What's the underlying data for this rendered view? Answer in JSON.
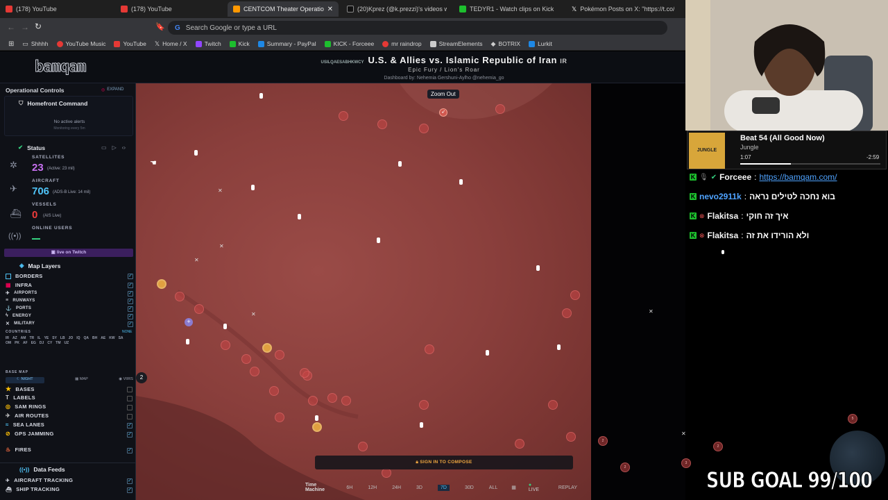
{
  "browser": {
    "tabs": [
      {
        "label": "(178) YouTube",
        "color": "#e53935"
      },
      {
        "label": "(178) YouTube",
        "color": "#e53935"
      },
      {
        "label": "CENTCOM Theater Operations M",
        "color": "#ff9800"
      },
      {
        "label": "(20)Kprez (@k.prezzi)'s videos with c",
        "color": "#111111"
      },
      {
        "label": "TEDYR1 - Watch clips on Kick",
        "color": "#1dbf2e"
      },
      {
        "label": "Pokémon Posts on X: \"https://t.co/8i",
        "color": "#222222"
      }
    ],
    "omnibox_placeholder": "Search Google or type a URL",
    "bookmarks": [
      {
        "label": "Shhhh",
        "color": "#888888"
      },
      {
        "label": "YouTube Music",
        "color": "#e53935"
      },
      {
        "label": "YouTube",
        "color": "#e53935"
      },
      {
        "label": "Home / X",
        "color": "#dddddd"
      },
      {
        "label": "Twitch",
        "color": "#9146ff"
      },
      {
        "label": "Kick",
        "color": "#1dbf2e"
      },
      {
        "label": "Summary - PayPal",
        "color": "#1e88e5"
      },
      {
        "label": "KICK - Forceee",
        "color": "#1dbf2e"
      },
      {
        "label": "mr raindrop",
        "color": "#e53935"
      },
      {
        "label": "StreamElements",
        "color": "#cccccc"
      },
      {
        "label": "BOTRIX",
        "color": "#cccccc"
      },
      {
        "label": "Lurkit",
        "color": "#1e88e5"
      }
    ]
  },
  "header": {
    "logo": "bamqam",
    "prefix": "USILQAESABHKWCY",
    "title": "U.S. & Allies vs. Islamic Republic of Iran",
    "flag_code": "IR",
    "subtitle": "Epic Fury / Lion's Roar",
    "byline": "Dashboard by: Nehemia Gershuni-Aylho @nehemia_go"
  },
  "panel": {
    "title": "Operational Controls",
    "expand": "EXPAND",
    "homefront": {
      "title": "Homefront Command",
      "alert": "No active alerts",
      "sub": "Monitoring every 5m"
    },
    "status": {
      "title": "Status",
      "satellites": {
        "label": "SATELLITES",
        "value": "23",
        "note": "(Active: 23 mil)"
      },
      "aircraft": {
        "label": "AIRCRAFT",
        "value": "706",
        "note": "(ADS-B Live: 14 mil)"
      },
      "vessels": {
        "label": "VESSELS",
        "value": "0",
        "note": "(AIS Live)"
      },
      "online": {
        "label": "ONLINE USERS"
      }
    },
    "live_button": "live on Twitch",
    "map_layers": {
      "title": "Map Layers",
      "items": [
        {
          "label": "BORDERS",
          "checked": true
        },
        {
          "label": "INFRA",
          "checked": true
        },
        {
          "label": "AIRPORTS",
          "checked": true
        },
        {
          "label": "RUNWAYS",
          "checked": true
        },
        {
          "label": "PORTS",
          "checked": true
        },
        {
          "label": "ENERGY",
          "checked": true
        },
        {
          "label": "MILITARY",
          "checked": true
        }
      ],
      "countries_label": "COUNTRIES",
      "countries_none": "NONE",
      "countries": [
        "IR",
        "AZ",
        "AM",
        "TR",
        "IL",
        "YE",
        "SY",
        "LB",
        "JO",
        "IQ",
        "QA",
        "BH",
        "AE",
        "KW",
        "SA",
        "OM",
        "PK",
        "AF",
        "EG",
        "DJ",
        "CY",
        "TM",
        "UZ"
      ]
    },
    "base_map": {
      "label": "BASE MAP",
      "options": [
        "NIGHT",
        "MAP",
        "VIIRS"
      ],
      "items": [
        {
          "label": "BASES",
          "checked": false
        },
        {
          "label": "LABELS",
          "checked": false
        },
        {
          "label": "SAM RINGS",
          "checked": false
        },
        {
          "label": "AIR ROUTES",
          "checked": false
        },
        {
          "label": "SEA LANES",
          "checked": true
        },
        {
          "label": "GPS JAMMING",
          "checked": true
        },
        {
          "label": "FIRES",
          "checked": true
        }
      ]
    },
    "data_feeds": {
      "title": "Data Feeds",
      "items": [
        {
          "label": "AIRCRAFT TRACKING",
          "checked": true
        },
        {
          "label": "SHIP TRACKING",
          "checked": true
        }
      ]
    }
  },
  "map": {
    "zoom_out": "Zoom Out",
    "sign_in": "SIGN IN TO COMPOSE",
    "cluster_badge": "2",
    "timebar": {
      "label": "Time Machine",
      "options": [
        "6H",
        "12H",
        "24H",
        "3D",
        "7D",
        "30D",
        "ALL"
      ],
      "selected": "7D",
      "live": "LIVE",
      "replay": "REPLAY"
    }
  },
  "music": {
    "title": "Beat 54 (All Good Now)",
    "artist": "Jungle",
    "elapsed": "1:07",
    "remaining": "-2:59",
    "progress": 0.36,
    "cover_text": "JUNGLE"
  },
  "chat": [
    {
      "user": "Forceee",
      "user_color": "#f5f5f5",
      "message": "https://bamqam.com/",
      "msg_color": "#4fa3ff"
    },
    {
      "user": "nevo2911k",
      "user_color": "#4fa3ff",
      "message": "בוא נחכה לטילים נראה",
      "msg_color": "#ffffff"
    },
    {
      "user": "Flakitsa",
      "user_color": "#f5f5f5",
      "message": "איך זה חוקי",
      "msg_color": "#ffffff"
    },
    {
      "user": "Flakitsa",
      "user_color": "#f5f5f5",
      "message": "ולא הורידו את זה",
      "msg_color": "#ffffff"
    }
  ],
  "overlay": {
    "sub_goal": "SUB GOAL 99/100"
  }
}
